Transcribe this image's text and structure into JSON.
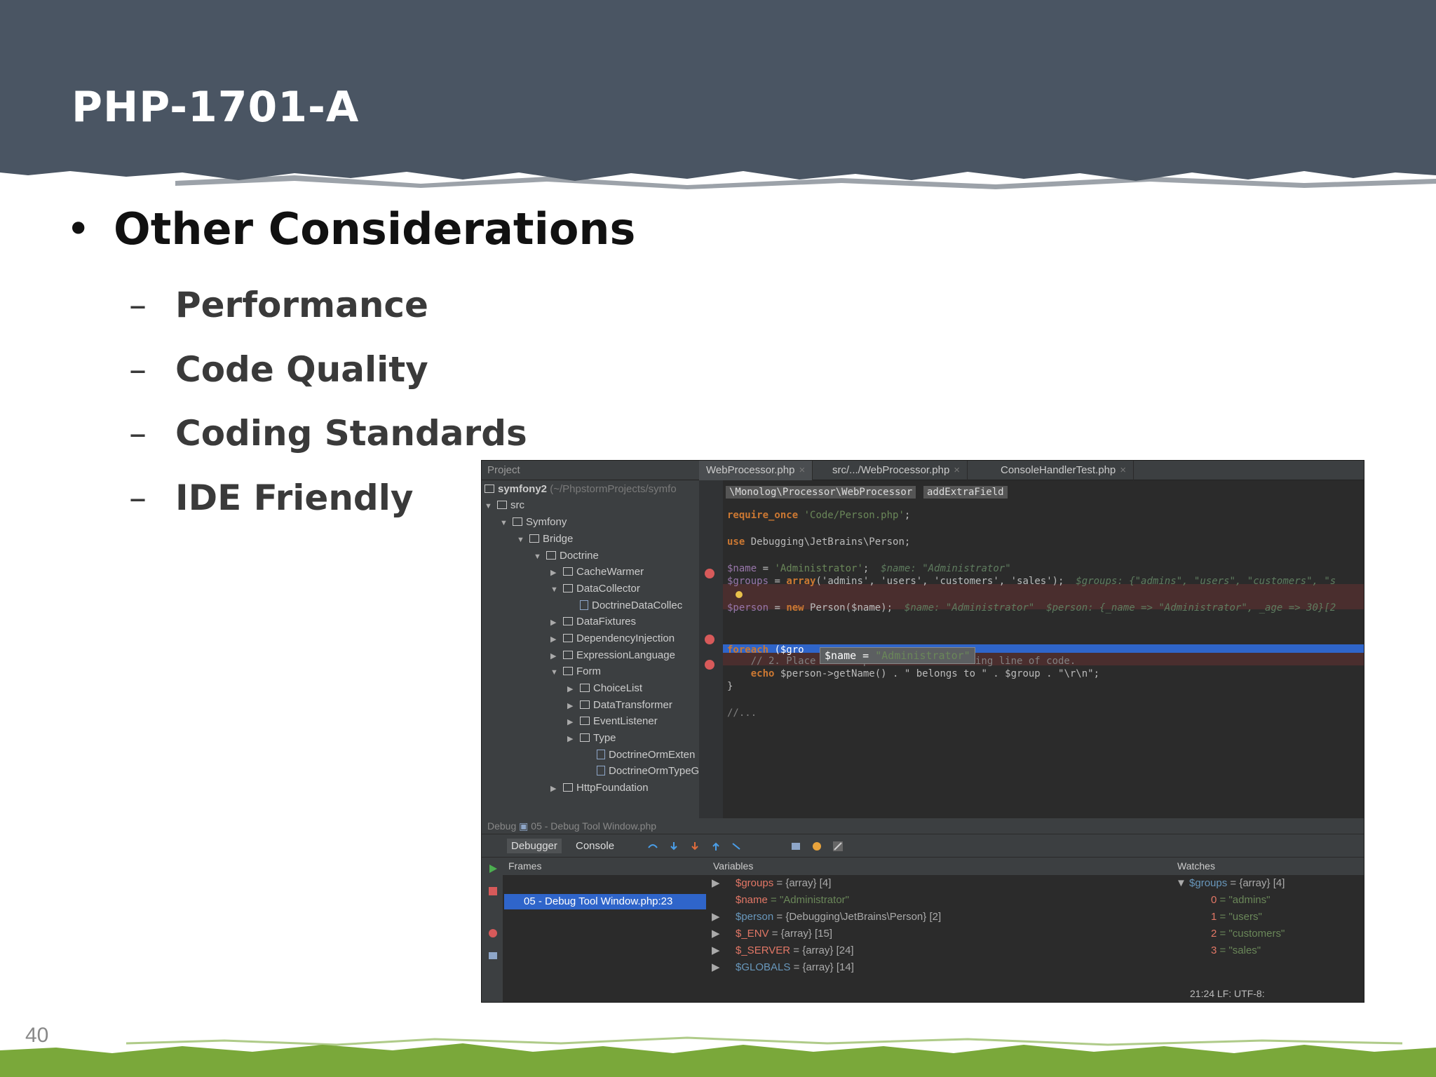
{
  "slide": {
    "title": "PHP-1701-A",
    "bullet": "Other Considerations",
    "subitems": [
      "Performance",
      "Code Quality",
      "Coding Standards",
      "IDE Friendly"
    ],
    "dash": "–",
    "page_number": "40",
    "colors": {
      "banner": "#4a5563",
      "footer": "#7aa83a"
    }
  },
  "ide": {
    "project_label": "Project",
    "tabs": [
      "WebProcessor.php",
      "src/.../WebProcessor.php",
      "ConsoleHandlerTest.php"
    ],
    "tree": {
      "root_name": "symfony2",
      "root_path": "(~/PhpstormProjects/symfo",
      "items": [
        "src",
        "Symfony",
        "Bridge",
        "Doctrine",
        "CacheWarmer",
        "DataCollector",
        "DoctrineDataCollec",
        "DataFixtures",
        "DependencyInjection",
        "ExpressionLanguage",
        "Form",
        "ChoiceList",
        "DataTransformer",
        "EventListener",
        "Type",
        "DoctrineOrmExten",
        "DoctrineOrmTypeG",
        "HttpFoundation"
      ]
    },
    "breadcrumbs": [
      "\\Monolog\\Processor\\WebProcessor",
      "addExtraField"
    ],
    "code": {
      "l1_kw": "require_once",
      "l1_str": "'Code/Person.php'",
      "l1_end": ";",
      "l2_kw": "use",
      "l2_rest": " Debugging\\JetBrains\\Person;",
      "l3_var": "$name",
      "l3_mid": " = ",
      "l3_str": "'Administrator'",
      "l3_end": ";",
      "l3_inl": "$name: \"Administrator\"",
      "l4_var": "$groups",
      "l4_mid": " = ",
      "l4_kw": "array",
      "l4_args": "('admins', 'users', 'customers', 'sales');",
      "l4_inl": "$groups: {\"admins\", \"users\", \"customers\", \"s",
      "l5_var": "$person",
      "l5_mid": " = ",
      "l5_kw": "new",
      "l5_rest": " Person($name);",
      "l5_inl": "$name: \"Administrator\"  $person: {_name => \"Administrator\", _age => 30}[2",
      "l6_kw": "foreach",
      "l6_rest": " ($gro",
      "l7": "    // 2. Place a breakpoint on the following line of code.",
      "l8_kw": "echo",
      "l8_rest": " $person->getName() . \" belongs to \" . $group . \"\\r\\n\";",
      "l9": "}",
      "l10": "//..."
    },
    "tooltip_var": "$name",
    "tooltip_eq": " = ",
    "tooltip_val": "\"Administrator\"",
    "debug_bar": "Debug",
    "debug_file": "05 - Debug Tool Window.php",
    "debug_tabs": [
      "Debugger",
      "Console"
    ],
    "frames_header": "Frames",
    "frame_selected": "05 - Debug Tool Window.php:23",
    "variables_header": "Variables",
    "variables": [
      {
        "name": "$groups",
        "value": "= {array} [4]"
      },
      {
        "name": "$name",
        "value": "= \"Administrator\""
      },
      {
        "name": "$person",
        "value": "= {Debugging\\JetBrains\\Person} [2]"
      },
      {
        "name": "$_ENV",
        "value": "= {array} [15]"
      },
      {
        "name": "$_SERVER",
        "value": "= {array} [24]"
      },
      {
        "name": "$GLOBALS",
        "value": "= {array} [14]"
      }
    ],
    "watches_header": "Watches",
    "watch_root": {
      "name": "$groups",
      "value": "= {array} [4]"
    },
    "watch_items": [
      {
        "idx": "0",
        "value": "= \"admins\""
      },
      {
        "idx": "1",
        "value": "= \"users\""
      },
      {
        "idx": "2",
        "value": "= \"customers\""
      },
      {
        "idx": "3",
        "value": "= \"sales\""
      }
    ],
    "status": "21:24   LF:   UTF-8:"
  }
}
